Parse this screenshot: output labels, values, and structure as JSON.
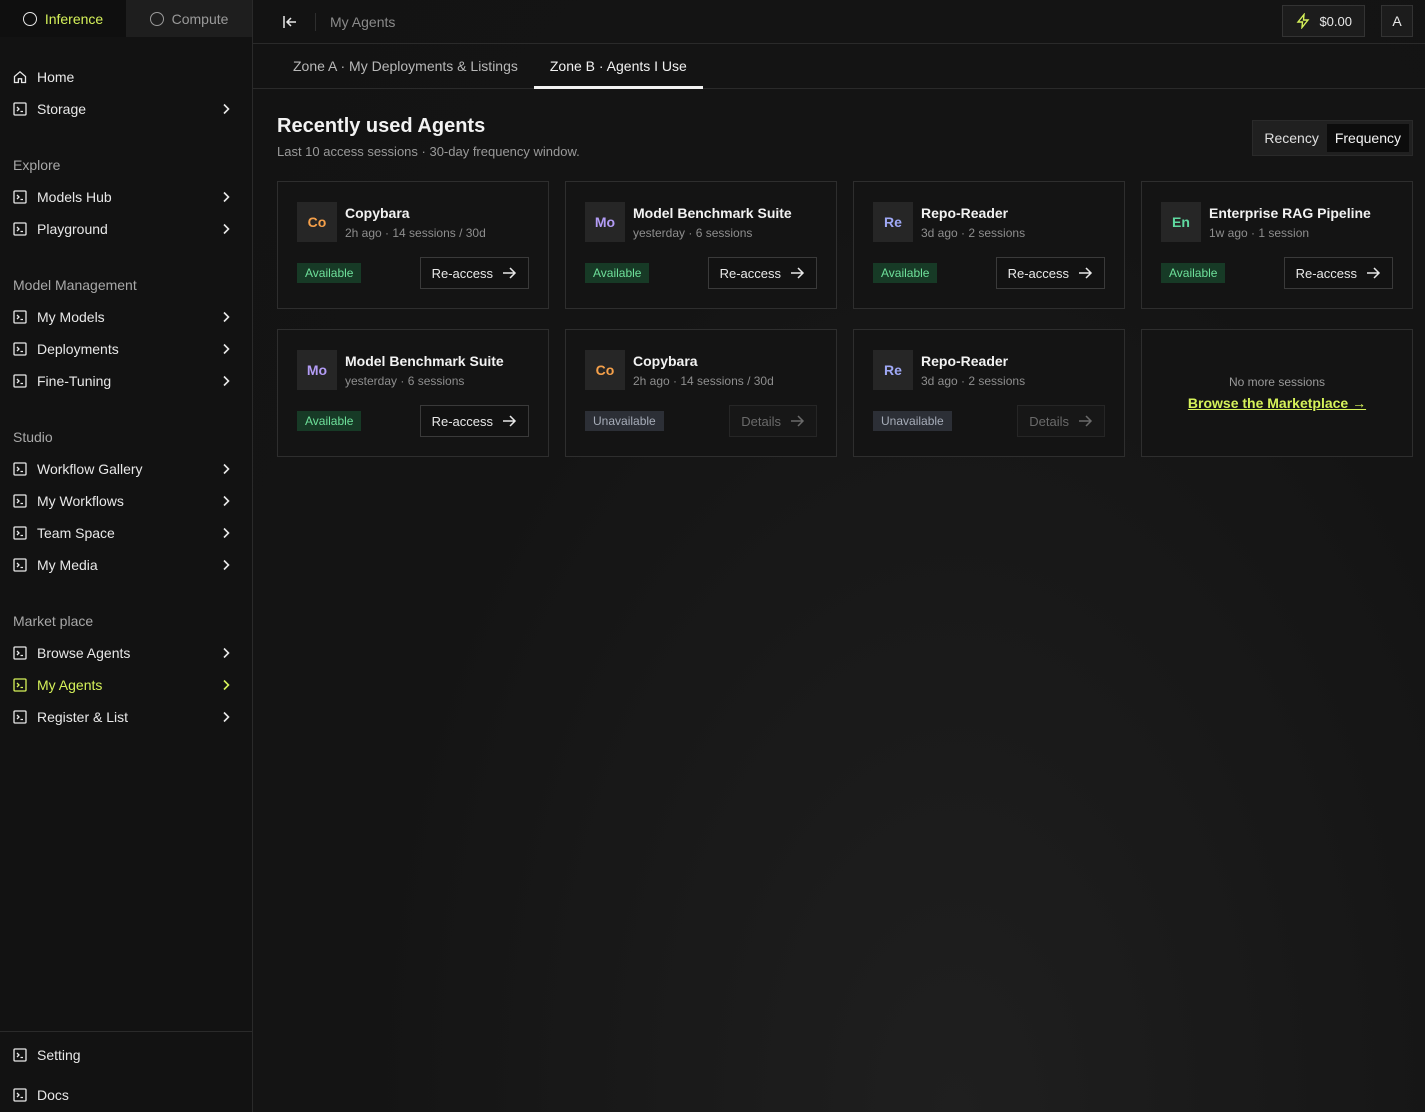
{
  "colors": {
    "accent": "#d6f25a",
    "available": "#6ee09a",
    "unavailable": "#a6acb8"
  },
  "sidebar": {
    "switch": {
      "inference": "Inference",
      "compute": "Compute"
    },
    "home": "Home",
    "storage": "Storage",
    "sections": {
      "explore": "Explore",
      "model_management": "Model Management",
      "studio": "Studio",
      "marketplace": "Market place"
    },
    "items": {
      "models_hub": "Models Hub",
      "playground": "Playground",
      "my_models": "My Models",
      "deployments": "Deployments",
      "fine_tuning": "Fine-Tuning",
      "workflow_gallery": "Workflow Gallery",
      "my_workflows": "My Workflows",
      "team_space": "Team Space",
      "my_media": "My Media",
      "browse_agents": "Browse Agents",
      "my_agents": "My Agents",
      "register_list": "Register & List"
    },
    "setting": "Setting",
    "docs": "Docs"
  },
  "topbar": {
    "breadcrumb": "My Agents",
    "balance": "$0.00",
    "avatar": "A"
  },
  "tabs": {
    "zone_a": "Zone A · My Deployments & Listings",
    "zone_b": "Zone B · Agents I Use"
  },
  "main": {
    "title": "Recently used Agents",
    "subtitle": "Last 10 access sessions · 30-day frequency window.",
    "sort": {
      "recency": "Recency",
      "frequency": "Frequency"
    },
    "cards": [
      {
        "badge": "Co",
        "badge_color": "#f5a04a",
        "name": "Copybara",
        "meta": "2h ago · 14 sessions / 30d",
        "status": "Available",
        "action": "Re-access"
      },
      {
        "badge": "Mo",
        "badge_color": "#b39cf5",
        "name": "Model Benchmark Suite",
        "meta": "yesterday · 6 sessions",
        "status": "Available",
        "action": "Re-access"
      },
      {
        "badge": "Re",
        "badge_color": "#9fa8f5",
        "name": "Repo-Reader",
        "meta": "3d ago · 2 sessions",
        "status": "Available",
        "action": "Re-access"
      },
      {
        "badge": "En",
        "badge_color": "#5fd9a0",
        "name": "Enterprise RAG Pipeline",
        "meta": "1w ago · 1 session",
        "status": "Available",
        "action": "Re-access"
      },
      {
        "badge": "Mo",
        "badge_color": "#b39cf5",
        "name": "Model Benchmark Suite",
        "meta": "yesterday · 6 sessions",
        "status": "Available",
        "action": "Re-access"
      },
      {
        "badge": "Co",
        "badge_color": "#f5a04a",
        "name": "Copybara",
        "meta": "2h ago · 14 sessions / 30d",
        "status": "Unavailable",
        "action": "Details"
      },
      {
        "badge": "Re",
        "badge_color": "#9fa8f5",
        "name": "Repo-Reader",
        "meta": "3d ago · 2 sessions",
        "status": "Unavailable",
        "action": "Details"
      }
    ],
    "end_card": {
      "text": "No more sessions",
      "link": "Browse the Marketplace →"
    }
  }
}
